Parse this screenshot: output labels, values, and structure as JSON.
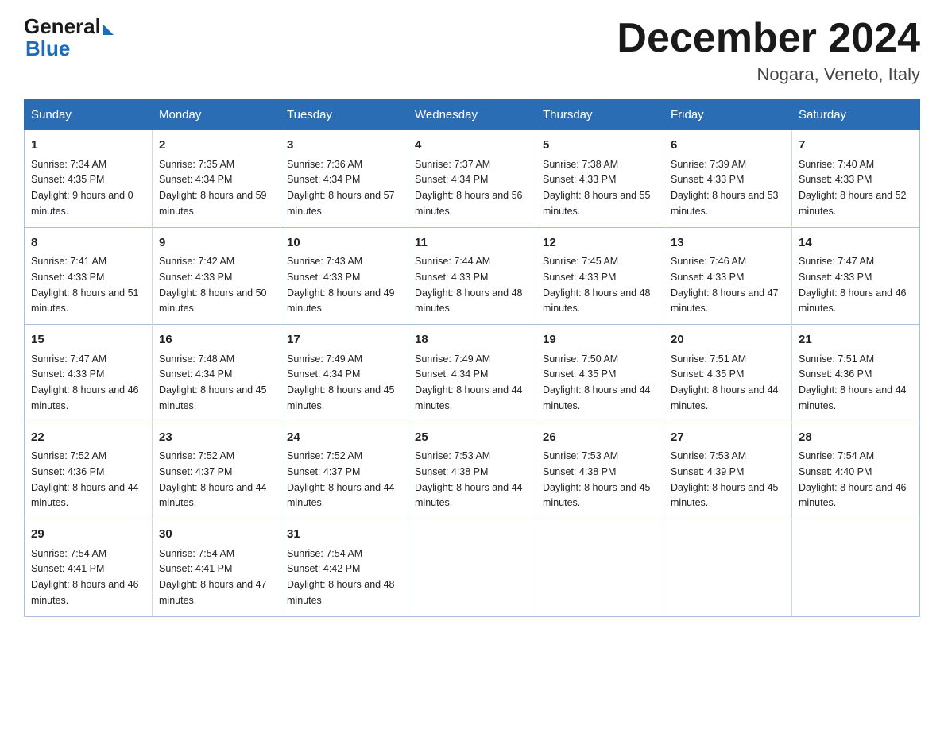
{
  "header": {
    "logo_general": "General",
    "logo_blue": "Blue",
    "title": "December 2024",
    "subtitle": "Nogara, Veneto, Italy"
  },
  "days_of_week": [
    "Sunday",
    "Monday",
    "Tuesday",
    "Wednesday",
    "Thursday",
    "Friday",
    "Saturday"
  ],
  "weeks": [
    [
      {
        "day": "1",
        "sunrise": "7:34 AM",
        "sunset": "4:35 PM",
        "daylight": "9 hours and 0 minutes."
      },
      {
        "day": "2",
        "sunrise": "7:35 AM",
        "sunset": "4:34 PM",
        "daylight": "8 hours and 59 minutes."
      },
      {
        "day": "3",
        "sunrise": "7:36 AM",
        "sunset": "4:34 PM",
        "daylight": "8 hours and 57 minutes."
      },
      {
        "day": "4",
        "sunrise": "7:37 AM",
        "sunset": "4:34 PM",
        "daylight": "8 hours and 56 minutes."
      },
      {
        "day": "5",
        "sunrise": "7:38 AM",
        "sunset": "4:33 PM",
        "daylight": "8 hours and 55 minutes."
      },
      {
        "day": "6",
        "sunrise": "7:39 AM",
        "sunset": "4:33 PM",
        "daylight": "8 hours and 53 minutes."
      },
      {
        "day": "7",
        "sunrise": "7:40 AM",
        "sunset": "4:33 PM",
        "daylight": "8 hours and 52 minutes."
      }
    ],
    [
      {
        "day": "8",
        "sunrise": "7:41 AM",
        "sunset": "4:33 PM",
        "daylight": "8 hours and 51 minutes."
      },
      {
        "day": "9",
        "sunrise": "7:42 AM",
        "sunset": "4:33 PM",
        "daylight": "8 hours and 50 minutes."
      },
      {
        "day": "10",
        "sunrise": "7:43 AM",
        "sunset": "4:33 PM",
        "daylight": "8 hours and 49 minutes."
      },
      {
        "day": "11",
        "sunrise": "7:44 AM",
        "sunset": "4:33 PM",
        "daylight": "8 hours and 48 minutes."
      },
      {
        "day": "12",
        "sunrise": "7:45 AM",
        "sunset": "4:33 PM",
        "daylight": "8 hours and 48 minutes."
      },
      {
        "day": "13",
        "sunrise": "7:46 AM",
        "sunset": "4:33 PM",
        "daylight": "8 hours and 47 minutes."
      },
      {
        "day": "14",
        "sunrise": "7:47 AM",
        "sunset": "4:33 PM",
        "daylight": "8 hours and 46 minutes."
      }
    ],
    [
      {
        "day": "15",
        "sunrise": "7:47 AM",
        "sunset": "4:33 PM",
        "daylight": "8 hours and 46 minutes."
      },
      {
        "day": "16",
        "sunrise": "7:48 AM",
        "sunset": "4:34 PM",
        "daylight": "8 hours and 45 minutes."
      },
      {
        "day": "17",
        "sunrise": "7:49 AM",
        "sunset": "4:34 PM",
        "daylight": "8 hours and 45 minutes."
      },
      {
        "day": "18",
        "sunrise": "7:49 AM",
        "sunset": "4:34 PM",
        "daylight": "8 hours and 44 minutes."
      },
      {
        "day": "19",
        "sunrise": "7:50 AM",
        "sunset": "4:35 PM",
        "daylight": "8 hours and 44 minutes."
      },
      {
        "day": "20",
        "sunrise": "7:51 AM",
        "sunset": "4:35 PM",
        "daylight": "8 hours and 44 minutes."
      },
      {
        "day": "21",
        "sunrise": "7:51 AM",
        "sunset": "4:36 PM",
        "daylight": "8 hours and 44 minutes."
      }
    ],
    [
      {
        "day": "22",
        "sunrise": "7:52 AM",
        "sunset": "4:36 PM",
        "daylight": "8 hours and 44 minutes."
      },
      {
        "day": "23",
        "sunrise": "7:52 AM",
        "sunset": "4:37 PM",
        "daylight": "8 hours and 44 minutes."
      },
      {
        "day": "24",
        "sunrise": "7:52 AM",
        "sunset": "4:37 PM",
        "daylight": "8 hours and 44 minutes."
      },
      {
        "day": "25",
        "sunrise": "7:53 AM",
        "sunset": "4:38 PM",
        "daylight": "8 hours and 44 minutes."
      },
      {
        "day": "26",
        "sunrise": "7:53 AM",
        "sunset": "4:38 PM",
        "daylight": "8 hours and 45 minutes."
      },
      {
        "day": "27",
        "sunrise": "7:53 AM",
        "sunset": "4:39 PM",
        "daylight": "8 hours and 45 minutes."
      },
      {
        "day": "28",
        "sunrise": "7:54 AM",
        "sunset": "4:40 PM",
        "daylight": "8 hours and 46 minutes."
      }
    ],
    [
      {
        "day": "29",
        "sunrise": "7:54 AM",
        "sunset": "4:41 PM",
        "daylight": "8 hours and 46 minutes."
      },
      {
        "day": "30",
        "sunrise": "7:54 AM",
        "sunset": "4:41 PM",
        "daylight": "8 hours and 47 minutes."
      },
      {
        "day": "31",
        "sunrise": "7:54 AM",
        "sunset": "4:42 PM",
        "daylight": "8 hours and 48 minutes."
      },
      null,
      null,
      null,
      null
    ]
  ]
}
